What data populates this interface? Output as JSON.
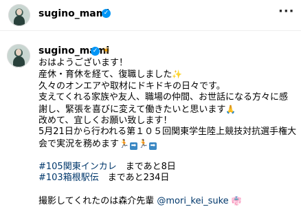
{
  "header": {
    "username": "sugino_mami",
    "verified": "✓",
    "more": "···"
  },
  "post": {
    "username": "sugino_mami",
    "verified": "✓",
    "sun_emoji": "☀",
    "lines": [
      "おはようございます！",
      "産休・育休を経て、復職しました",
      "久々のオンエアや取材にドキドキの日々です。",
      "支えてくれる家族や友人、職場の仲間、お世話になる方々に感",
      "謝し、緊張を喜びに変えて働きたいと思います",
      "改めて、宜しくお願い致します！",
      "5月21日から行われる第１０５回関東学生陸上競技対抗選手権大",
      "会で実況を務めます"
    ],
    "sparkle_emoji": "✨",
    "hands_emoji": "🙏",
    "runner_emoji": "🏃",
    "arrow": "➡",
    "tags": [
      {
        "tag": "#105関東インカレ",
        "rest": "　まであと8日"
      },
      {
        "tag": "#103箱根駅伝",
        "rest": "　まであと234日"
      }
    ],
    "credit": "撮影してくれたのは森介先輩 ",
    "mention": "@mori_kei_suke",
    "credit_emoji": "👘"
  }
}
